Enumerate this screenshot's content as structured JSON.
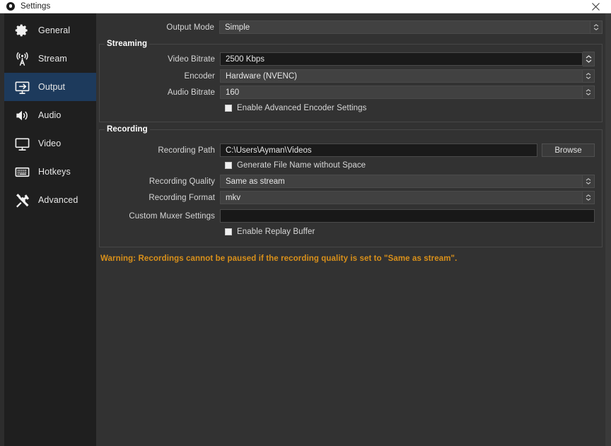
{
  "window": {
    "title": "Settings",
    "logo_icon": "obs-logo-icon",
    "close_icon": "close-icon"
  },
  "sidebar": {
    "items": [
      {
        "label": "General",
        "icon": "gear-icon",
        "selected": false
      },
      {
        "label": "Stream",
        "icon": "broadcast-icon",
        "selected": false
      },
      {
        "label": "Output",
        "icon": "output-icon",
        "selected": true
      },
      {
        "label": "Audio",
        "icon": "speaker-icon",
        "selected": false
      },
      {
        "label": "Video",
        "icon": "monitor-icon",
        "selected": false
      },
      {
        "label": "Hotkeys",
        "icon": "keyboard-icon",
        "selected": false
      },
      {
        "label": "Advanced",
        "icon": "wrench-icon",
        "selected": false
      }
    ]
  },
  "output_mode": {
    "label": "Output Mode",
    "value": "Simple"
  },
  "streaming": {
    "title": "Streaming",
    "video_bitrate": {
      "label": "Video Bitrate",
      "value": "2500 Kbps"
    },
    "encoder": {
      "label": "Encoder",
      "value": "Hardware (NVENC)"
    },
    "audio_bitrate": {
      "label": "Audio Bitrate",
      "value": "160"
    },
    "advanced_encoder": {
      "label": "Enable Advanced Encoder Settings",
      "checked": false
    }
  },
  "recording": {
    "title": "Recording",
    "path": {
      "label": "Recording Path",
      "value": "C:\\Users\\Ayman\\Videos"
    },
    "browse_label": "Browse",
    "no_space": {
      "label": "Generate File Name without Space",
      "checked": false
    },
    "quality": {
      "label": "Recording Quality",
      "value": "Same as stream"
    },
    "format": {
      "label": "Recording Format",
      "value": "mkv"
    },
    "muxer": {
      "label": "Custom Muxer Settings",
      "value": "",
      "placeholder": ""
    },
    "replay_buffer": {
      "label": "Enable Replay Buffer",
      "checked": false
    }
  },
  "warning": {
    "text": "Warning: Recordings cannot be paused if the recording quality is set to \"Same as stream\"."
  },
  "colors": {
    "selection": "#1d3a5c",
    "warning": "#d9901a",
    "panel": "#323232",
    "sidebar": "#1f1f1f"
  }
}
